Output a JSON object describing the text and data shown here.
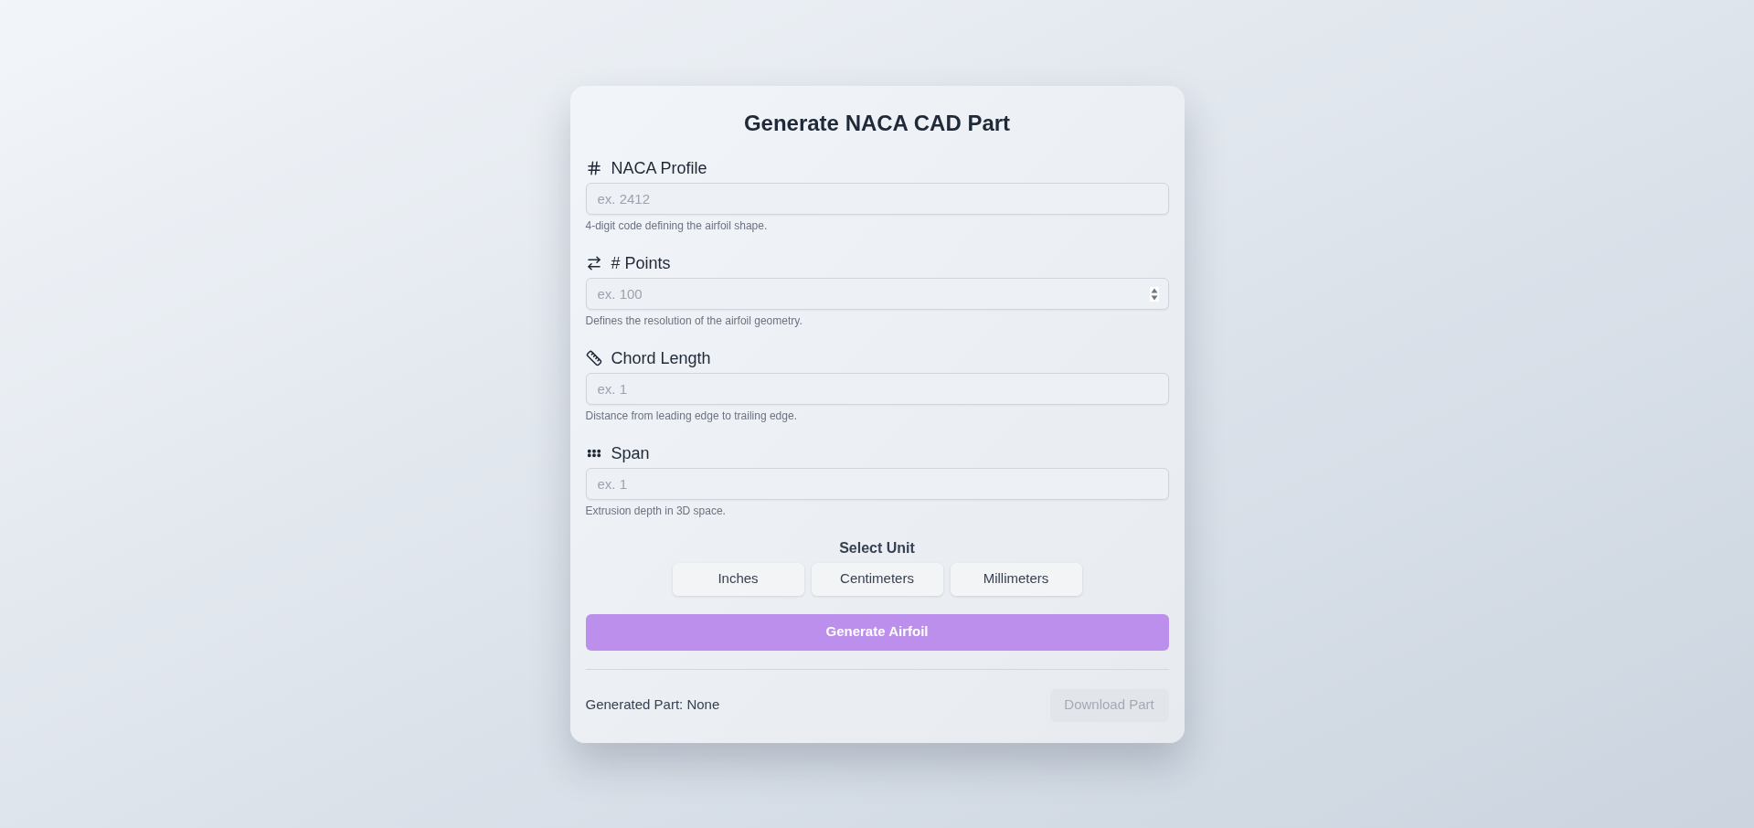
{
  "title": "Generate NACA CAD Part",
  "fields": [
    {
      "label": "NACA Profile",
      "kind": "text",
      "placeholder": "ex. 2412",
      "help": "4-digit code defining the airfoil shape."
    },
    {
      "label": "# Points",
      "kind": "number",
      "placeholder": "ex. 100",
      "help": "Defines the resolution of the airfoil geometry."
    },
    {
      "label": "Chord Length",
      "kind": "text",
      "placeholder": "ex. 1",
      "help": "Distance from leading edge to trailing edge."
    },
    {
      "label": "Span",
      "kind": "text",
      "placeholder": "ex. 1",
      "help": "Extrusion depth in 3D space."
    }
  ],
  "unit_selector": {
    "label": "Select Unit",
    "options": [
      {
        "label": "Inches",
        "selected": false
      },
      {
        "label": "Centimeters",
        "selected": false
      },
      {
        "label": "Millimeters",
        "selected": false
      }
    ]
  },
  "generate_button": {
    "label": "Generate Airfoil"
  },
  "result": {
    "text": "Generated Part: None"
  },
  "download_button": {
    "label": "Download Part",
    "disabled": true
  }
}
